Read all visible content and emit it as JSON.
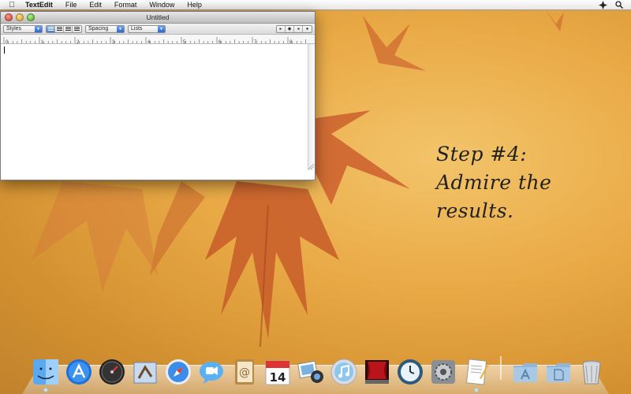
{
  "menubar": {
    "app_name": "TextEdit",
    "menus": [
      "File",
      "Edit",
      "Format",
      "Window",
      "Help"
    ]
  },
  "window": {
    "title": "Untitled",
    "toolbar": {
      "styles_label": "Styles",
      "spacing_label": "Spacing",
      "lists_label": "Lists",
      "alignment_active": "left"
    },
    "ruler_numbers": [
      "0",
      "1",
      "2",
      "3",
      "4",
      "5",
      "6",
      "7",
      "8"
    ]
  },
  "note": {
    "lines": [
      "Step #4:",
      "Admire the",
      "results."
    ]
  },
  "dock": {
    "calendar_day": "14",
    "apps": [
      "finder-icon",
      "app-store-icon",
      "dashboard-icon",
      "mail-icon",
      "safari-icon",
      "ichat-icon",
      "address-book-icon",
      "ical-icon",
      "iphoto-icon",
      "itunes-icon",
      "front-row-icon",
      "time-machine-icon",
      "system-preferences-icon",
      "textedit-icon"
    ],
    "stacks": [
      "applications-folder-icon",
      "documents-folder-icon"
    ],
    "trash": "trash-icon"
  },
  "colors": {
    "accent_blue": "#2a66d6",
    "wallpaper": "#e9a945",
    "leaf": "#c8582a"
  }
}
